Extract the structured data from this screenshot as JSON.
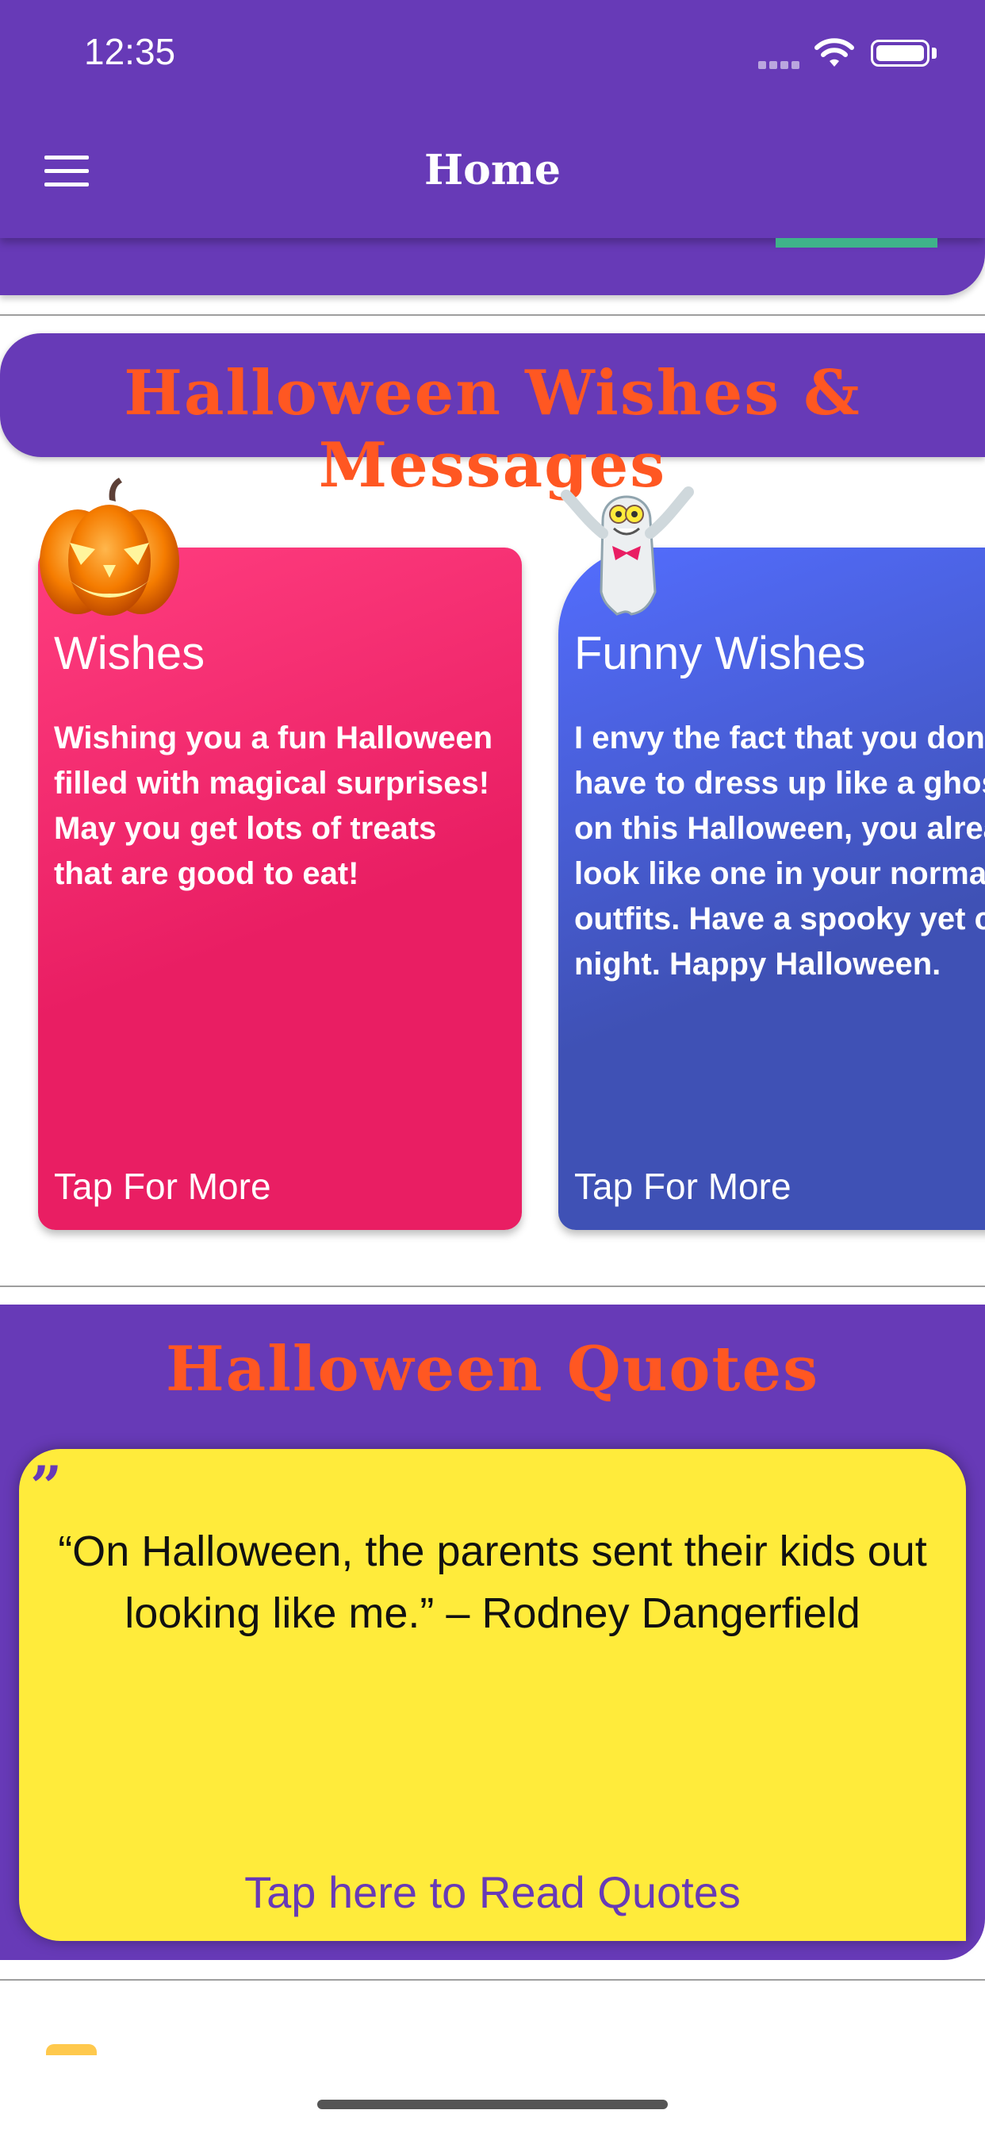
{
  "status_bar": {
    "time": "12:35"
  },
  "app_bar": {
    "title": "Home"
  },
  "wishes_section": {
    "title": "Halloween Wishes & Messages",
    "cards": [
      {
        "title": "Wishes",
        "text": "Wishing you a fun Halloween filled with magical surprises! May you get lots of treats that are good to eat!",
        "more": "Tap For More",
        "icon": "pumpkin-icon"
      },
      {
        "title": "Funny Wishes",
        "lines": [
          "I envy the fact that you don't",
          "have to dress up like a ghost",
          "on this Halloween, you already",
          "look like one in your normal",
          "outfits. Have a spooky yet cool",
          "night. Happy Halloween."
        ],
        "more": "Tap For More",
        "icon": "ghost-icon"
      }
    ]
  },
  "quotes_section": {
    "title": "Halloween Quotes",
    "quote": "“On Halloween, the parents sent their kids out looking like me.” – Rodney Dangerfield",
    "more": "Tap here to Read Quotes"
  },
  "colors": {
    "primary": "#673AB7",
    "accent": "#FF5722",
    "wishes_card": "#E91E63",
    "funny_card": "#3F51B5",
    "quote_card": "#FFEB3B",
    "indicator": "#3FB38A"
  }
}
